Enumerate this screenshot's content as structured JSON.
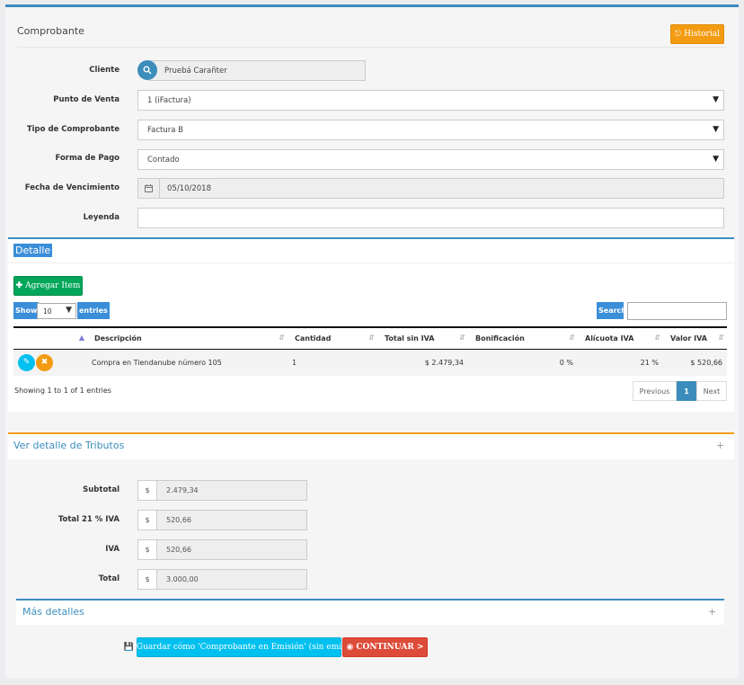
{
  "header": {
    "title": "Comprobante",
    "historial_label": "Historial"
  },
  "form": {
    "cliente": {
      "label": "Cliente",
      "value": "Pruebá Carañter"
    },
    "punto_venta": {
      "label": "Punto de Venta",
      "value": "1 (iFactura)"
    },
    "tipo_comprobante": {
      "label": "Tipo de Comprobante",
      "value": "Factura B"
    },
    "forma_pago": {
      "label": "Forma de Pago",
      "value": "Contado"
    },
    "fecha_vencimiento": {
      "label": "Fecha de Vencimiento",
      "value": "05/10/2018"
    },
    "leyenda": {
      "label": "Leyenda",
      "value": ""
    }
  },
  "detalle": {
    "title": "Detalle",
    "agregar_label": "Agregar Item",
    "show_label": "Show",
    "entries_label": "entries",
    "page_size": "10",
    "search_label": "Search:",
    "columns": [
      "Descripción",
      "Cantidad",
      "Total sin IVA",
      "Bonificación",
      "Alícuota IVA",
      "Valor IVA"
    ],
    "rows": [
      {
        "descripcion": "Compra en Tiendanube número 105",
        "cantidad": "1",
        "total_sin_iva": "$ 2.479,34",
        "bonificacion": "0 %",
        "alicuota": "21 %",
        "valor_iva": "$ 520,66"
      }
    ],
    "info": "Showing 1 to 1 of 1 entries",
    "pager": {
      "previous": "Previous",
      "current": "1",
      "next": "Next"
    }
  },
  "tributos": {
    "title": "Ver detalle de Tributos",
    "toggle": "+"
  },
  "totals": {
    "currency": "$",
    "subtotal": {
      "label": "Subtotal",
      "value": "2.479,34"
    },
    "total_iva": {
      "label": "Total 21 % IVA",
      "value": "520,66"
    },
    "iva": {
      "label": "IVA",
      "value": "520,66"
    },
    "total": {
      "label": "Total",
      "value": "3.000,00"
    }
  },
  "mas_detalles": {
    "title": "Más detalles",
    "toggle": "+"
  },
  "actions": {
    "guardar_label": "Guardar cómo 'Comprobante en Emisión' (sin emitir)",
    "continuar_label": "CONTINUAR >"
  },
  "colors": {
    "primary": "#3c8dbc",
    "warning": "#f39c12",
    "success": "#00a65a",
    "info": "#00c0ef",
    "danger": "#dd4b39"
  }
}
